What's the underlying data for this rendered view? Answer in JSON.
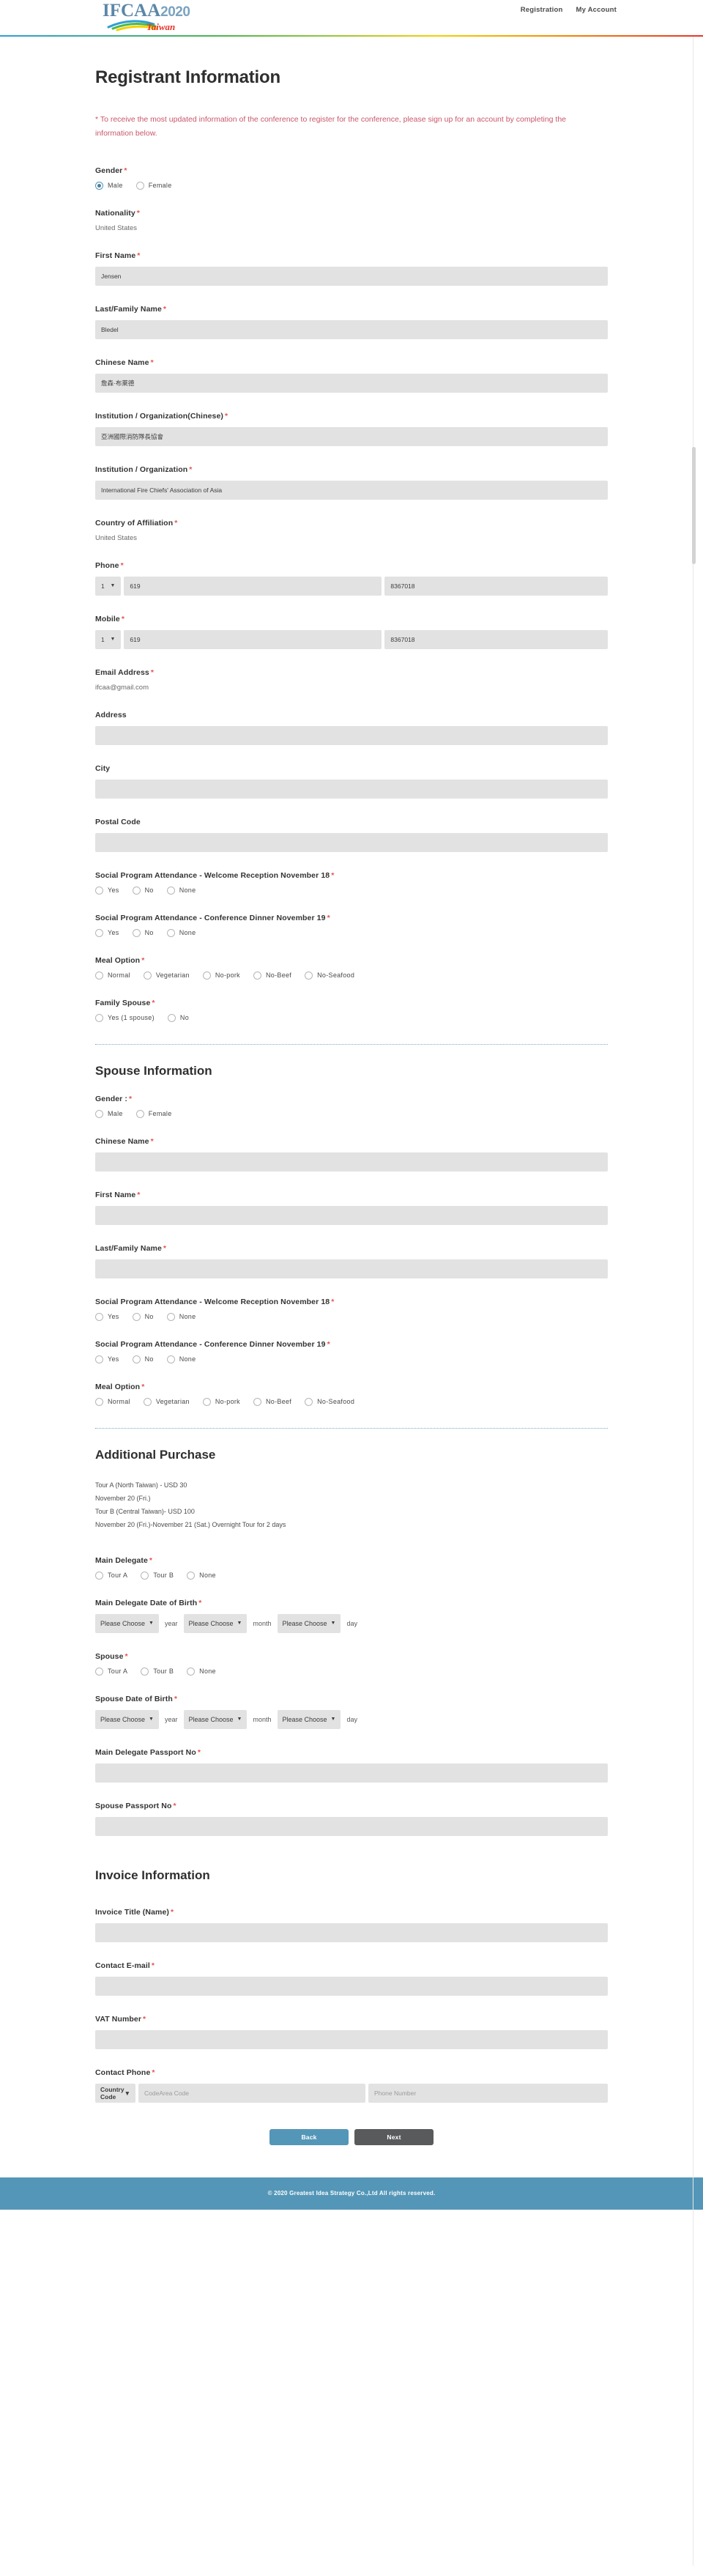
{
  "header": {
    "logo_text": "IFCAA",
    "logo_year": "2020",
    "logo_sub": "Taiwan",
    "nav": [
      {
        "label": "Registration"
      },
      {
        "label": "My Account"
      }
    ]
  },
  "page": {
    "title": "Registrant Information",
    "notice": "* To receive the most updated information of the conference to register for the conference, please sign up for an account by completing the information below."
  },
  "registrant": {
    "gender": {
      "label": "Gender",
      "required": "*",
      "options": [
        "Male",
        "Female"
      ],
      "selected": "Male"
    },
    "nationality": {
      "label": "Nationality",
      "required": "*",
      "value": "United States"
    },
    "first_name": {
      "label": "First Name",
      "required": "*",
      "value": "Jensen"
    },
    "last_name": {
      "label": "Last/Family Name",
      "required": "*",
      "value": "Bledel"
    },
    "chinese_name": {
      "label": "Chinese Name",
      "required": "*",
      "value": "詹森·布萊德"
    },
    "institution_cn": {
      "label": "Institution / Organization(Chinese)",
      "required": "*",
      "value": "亞洲國際消防隊長協會"
    },
    "institution_en": {
      "label": "Institution / Organization",
      "required": "*",
      "value": "International Fire Chiefs' Association of Asia"
    },
    "country_affiliation": {
      "label": "Country of Affiliation",
      "required": "*",
      "value": "United States"
    },
    "phone": {
      "label": "Phone",
      "required": "*",
      "country_code": "1",
      "area_code": "619",
      "number": "8367018"
    },
    "mobile": {
      "label": "Mobile",
      "required": "*",
      "country_code": "1",
      "area_code": "619",
      "number": "8367018"
    },
    "email": {
      "label": "Email Address",
      "required": "*",
      "value": "ifcaa@gmail.com"
    },
    "address": {
      "label": "Address",
      "required": "",
      "value": ""
    },
    "city": {
      "label": "City",
      "required": "",
      "value": ""
    },
    "postal_code": {
      "label": "Postal Code",
      "required": "",
      "value": ""
    },
    "welcome_reception": {
      "label": "Social Program Attendance - Welcome Reception November 18",
      "required": "*",
      "options": [
        "Yes",
        "No",
        "None"
      ],
      "selected": ""
    },
    "conference_dinner": {
      "label": "Social Program Attendance - Conference Dinner November 19",
      "required": "*",
      "options": [
        "Yes",
        "No",
        "None"
      ],
      "selected": ""
    },
    "meal_option": {
      "label": "Meal Option",
      "required": "*",
      "options": [
        "Normal",
        "Vegetarian",
        "No-pork",
        "No-Beef",
        "No-Seafood"
      ],
      "selected": ""
    },
    "family_spouse": {
      "label": "Family Spouse",
      "required": "*",
      "options": [
        "Yes (1 spouse)",
        "No"
      ],
      "selected": ""
    }
  },
  "spouse": {
    "section_title": "Spouse Information",
    "gender": {
      "label": "Gender :",
      "required": "*",
      "options": [
        "Male",
        "Female"
      ],
      "selected": ""
    },
    "chinese_name": {
      "label": "Chinese Name",
      "required": "*",
      "value": ""
    },
    "first_name": {
      "label": "First Name",
      "required": "*",
      "value": ""
    },
    "last_name": {
      "label": "Last/Family Name",
      "required": "*",
      "value": ""
    },
    "welcome_reception": {
      "label": "Social Program Attendance - Welcome Reception November 18",
      "required": "*",
      "options": [
        "Yes",
        "No",
        "None"
      ],
      "selected": ""
    },
    "conference_dinner": {
      "label": "Social Program Attendance - Conference Dinner November 19",
      "required": "*",
      "options": [
        "Yes",
        "No",
        "None"
      ],
      "selected": ""
    },
    "meal_option": {
      "label": "Meal Option",
      "required": "*",
      "options": [
        "Normal",
        "Vegetarian",
        "No-pork",
        "No-Beef",
        "No-Seafood"
      ],
      "selected": ""
    }
  },
  "additional_purchase": {
    "section_title": "Additional Purchase",
    "note_lines": [
      "Tour A (North Taiwan) - USD 30",
      "November 20 (Fri.)",
      "Tour B (Central Taiwan)- USD 100",
      "November 20 (Fri.)-November 21 (Sat.) Overnight Tour for 2 days"
    ],
    "main_delegate": {
      "label": "Main Delegate",
      "required": "*",
      "options": [
        "Tour A",
        "Tour B",
        "None"
      ],
      "selected": ""
    },
    "main_delegate_dob": {
      "label": "Main Delegate Date of Birth",
      "required": "*",
      "year": {
        "value": "Please Choose",
        "unit": "year"
      },
      "month": {
        "value": "Please Choose",
        "unit": "month"
      },
      "day": {
        "value": "Please Choose",
        "unit": "day"
      }
    },
    "spouse_tour": {
      "label": "Spouse",
      "required": "*",
      "options": [
        "Tour A",
        "Tour B",
        "None"
      ],
      "selected": ""
    },
    "spouse_dob": {
      "label": "Spouse Date of Birth",
      "required": "*",
      "year": {
        "value": "Please Choose",
        "unit": "year"
      },
      "month": {
        "value": "Please Choose",
        "unit": "month"
      },
      "day": {
        "value": "Please Choose",
        "unit": "day"
      }
    },
    "main_passport": {
      "label": "Main Delegate Passport No",
      "required": "*",
      "value": ""
    },
    "spouse_passport": {
      "label": "Spouse Passport No",
      "required": "*",
      "value": ""
    }
  },
  "invoice": {
    "section_title": "Invoice Information",
    "invoice_title": {
      "label": "Invoice Title (Name)",
      "required": "*",
      "value": ""
    },
    "contact_email": {
      "label": "Contact E-mail",
      "required": "*",
      "value": ""
    },
    "vat_number": {
      "label": "VAT Number",
      "required": "*",
      "value": ""
    },
    "contact_phone": {
      "label": "Contact Phone",
      "required": "*",
      "country_code": "Country Code",
      "area_placeholder": "CodeArea Code",
      "number_placeholder": "Phone Number"
    }
  },
  "actions": {
    "back_label": "Back",
    "next_label": "Next"
  },
  "footer": {
    "copyright": "© 2020 Greatest Idea Strategy Co.,Ltd All rights reserved."
  },
  "colors": {
    "accent_blue": "#5496b7",
    "required_red": "#e0564e",
    "notice_red": "#c9576a",
    "input_bg": "#e2e2e2",
    "next_gray": "#585a5c"
  }
}
